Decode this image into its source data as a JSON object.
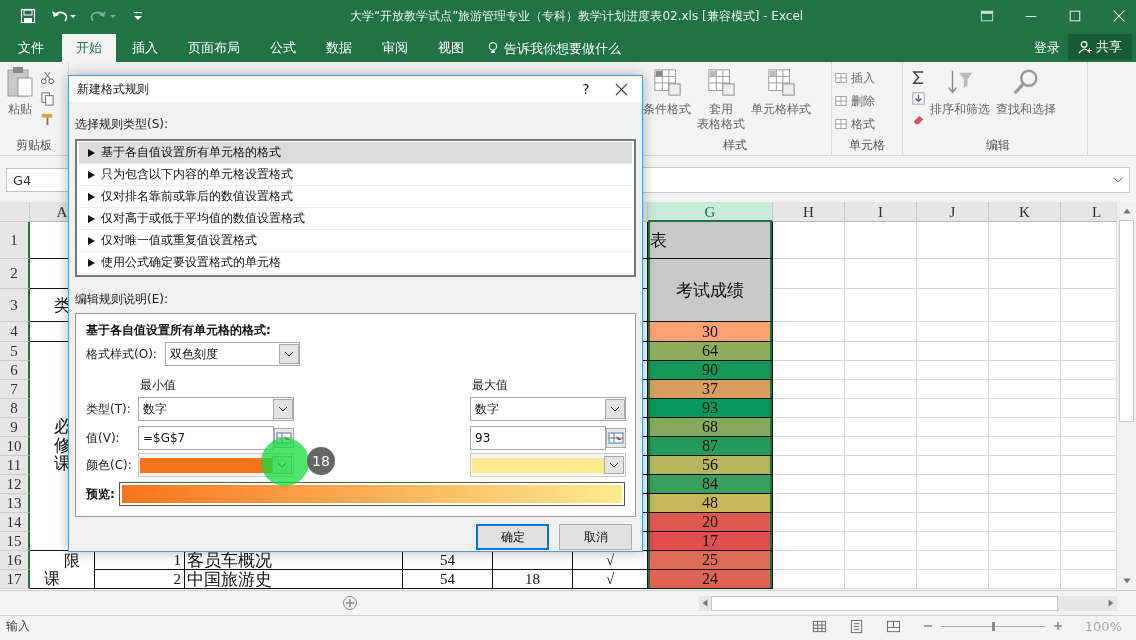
{
  "window": {
    "title": "大学“开放教学试点”旅游管理专业（专科）教学计划进度表02.xls  [兼容模式] - Excel"
  },
  "menu_tabs": [
    {
      "label": "文件",
      "selected": false
    },
    {
      "label": "开始",
      "selected": true
    },
    {
      "label": "插入",
      "selected": false
    },
    {
      "label": "页面布局",
      "selected": false
    },
    {
      "label": "公式",
      "selected": false
    },
    {
      "label": "数据",
      "selected": false
    },
    {
      "label": "审阅",
      "selected": false
    },
    {
      "label": "视图",
      "selected": false
    }
  ],
  "tell_me": {
    "placeholder": "告诉我你想要做什么"
  },
  "sign_in": "登录",
  "share": "共享",
  "ribbon": {
    "clipboard": {
      "paste": "粘贴",
      "label": "剪贴板"
    },
    "styles": {
      "buttons": [
        {
          "lines": [
            "条件格式"
          ]
        },
        {
          "lines": [
            "套用",
            "表格格式"
          ]
        },
        {
          "lines": [
            "单元格样式"
          ]
        }
      ],
      "label": "样式"
    },
    "cells": {
      "buttons": [
        "插入",
        "删除",
        "格式"
      ],
      "label": "单元格"
    },
    "editing": {
      "buttons": [
        {
          "lines": [
            "排序和筛选"
          ]
        },
        {
          "lines": [
            "查找和选择"
          ]
        }
      ],
      "label": "编辑"
    }
  },
  "name_box": "G4",
  "sheet": {
    "columns": [
      {
        "label": "A",
        "selected": false
      },
      {
        "label": "G",
        "selected": true
      },
      {
        "label": "H",
        "selected": false
      },
      {
        "label": "I",
        "selected": false
      },
      {
        "label": "J",
        "selected": false
      },
      {
        "label": "K",
        "selected": false
      },
      {
        "label": "L",
        "selected": false
      }
    ],
    "row_numbers": [
      "1",
      "2",
      "3",
      "4",
      "5",
      "6",
      "7",
      "8",
      "9",
      "10",
      "11",
      "12",
      "13",
      "14",
      "15",
      "16",
      "17"
    ],
    "title_tail": "表",
    "score_header": "考试成绩",
    "category": "类",
    "required": "必修课",
    "elective": [
      "限",
      "课"
    ],
    "courses": [
      {
        "no": "1",
        "name": "客员车概况",
        "hours": "54",
        "check": "√"
      },
      {
        "no": "2",
        "name": "中国旅游史",
        "hours": "54",
        "column_e": "18",
        "check": "√"
      }
    ],
    "scores": [
      {
        "text": "30",
        "color": "#fba372"
      },
      {
        "text": "64",
        "color": "#90ad5e"
      },
      {
        "text": "90",
        "color": "#12995a"
      },
      {
        "text": "37",
        "color": "#d79e5e"
      },
      {
        "text": "93",
        "color": "#06985a"
      },
      {
        "text": "68",
        "color": "#86aa5d"
      },
      {
        "text": "87",
        "color": "#249b5b"
      },
      {
        "text": "56",
        "color": "#b4b55d"
      },
      {
        "text": "84",
        "color": "#3a9e5c"
      },
      {
        "text": "48",
        "color": "#c9b65a"
      },
      {
        "text": "20",
        "color": "#de5a50"
      },
      {
        "text": "17",
        "color": "#e04e4d"
      },
      {
        "text": "25",
        "color": "#dd6c56"
      },
      {
        "text": "24",
        "color": "#dd6553"
      }
    ]
  },
  "dialog": {
    "title": "新建格式规则",
    "help": "?",
    "rule_type_label": "选择规则类型(S):",
    "rule_types": [
      {
        "label": "基于各自值设置所有单元格的格式",
        "selected": true
      },
      {
        "label": "只为包含以下内容的单元格设置格式",
        "selected": false
      },
      {
        "label": "仅对排名靠前或靠后的数值设置格式",
        "selected": false
      },
      {
        "label": "仅对高于或低于平均值的数值设置格式",
        "selected": false
      },
      {
        "label": "仅对唯一值或重复值设置格式",
        "selected": false
      },
      {
        "label": "使用公式确定要设置格式的单元格",
        "selected": false
      }
    ],
    "description_label": "编辑规则说明(E):",
    "heading": "基于各自值设置所有单元格的格式:",
    "format_style": {
      "label": "格式样式(O):",
      "value": "双色刻度"
    },
    "min_label": "最小值",
    "max_label": "最大值",
    "type_label": "类型(T):",
    "value_label": "值(V):",
    "color_label": "颜色(C):",
    "minimum": {
      "type": "数字",
      "value": "=$G$7",
      "color": "#f8741c"
    },
    "maximum": {
      "type": "数字",
      "value": "93",
      "color": "#fdea90"
    },
    "preview_label": "预览:",
    "buttons": [
      {
        "label": "确定",
        "default": true
      },
      {
        "label": "取消",
        "default": false
      }
    ]
  },
  "step_badge": "18",
  "status": "输入",
  "zoom_slider": {
    "level": 0.5
  },
  "zoom": "100%"
}
